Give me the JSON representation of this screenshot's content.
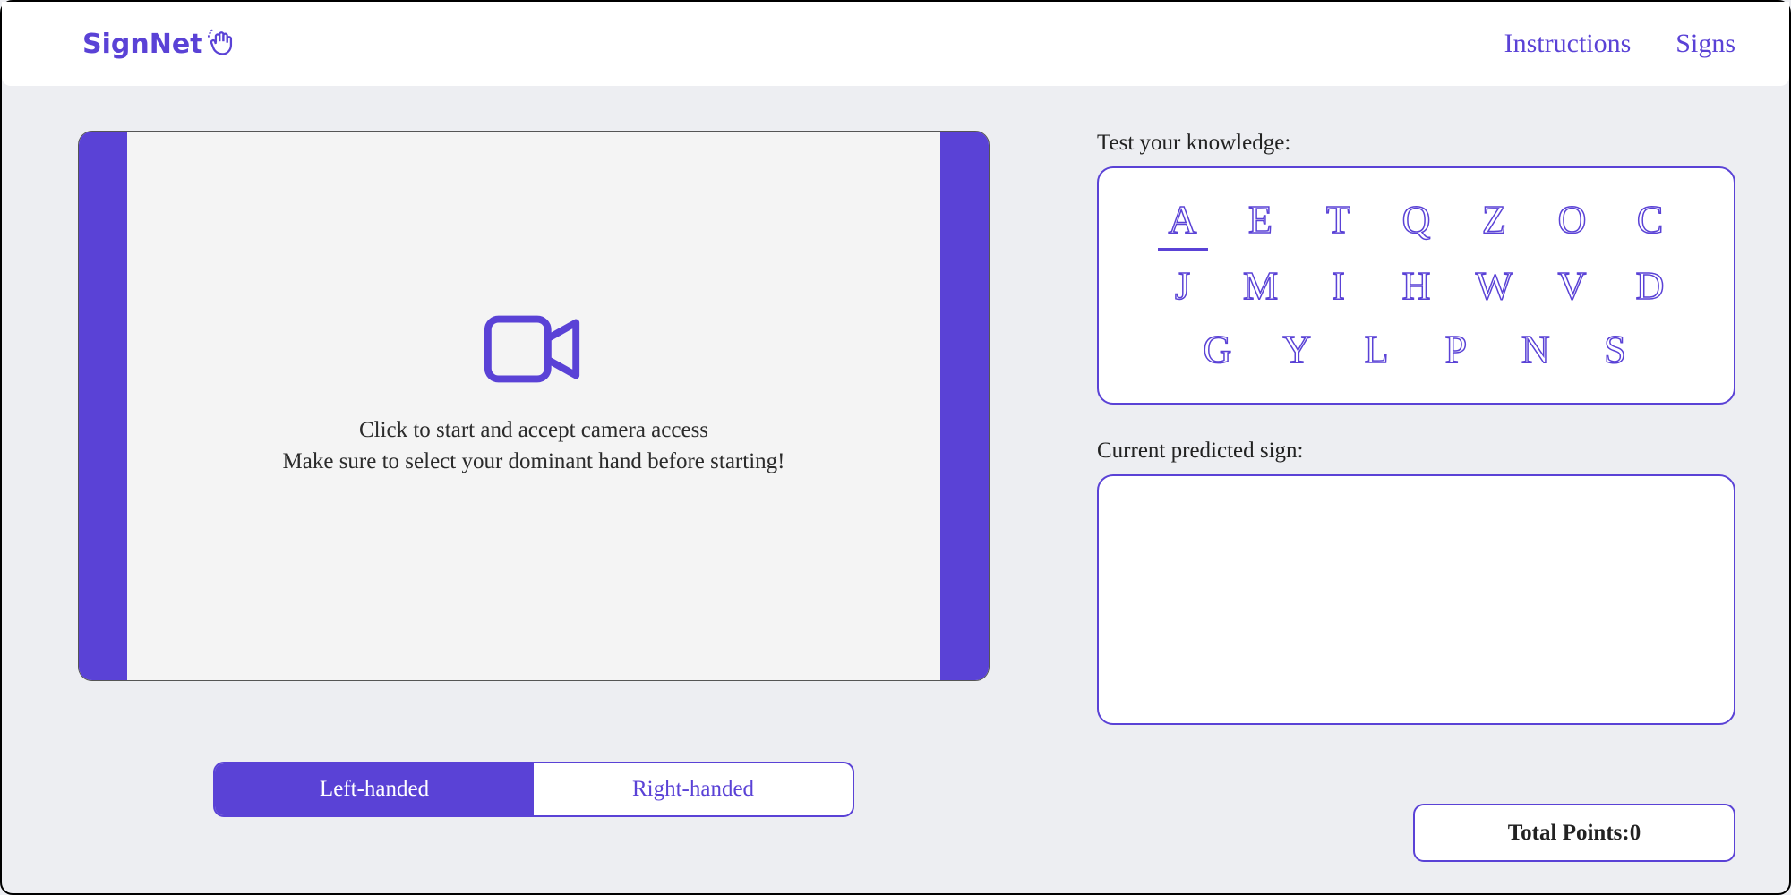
{
  "header": {
    "logo_text": "SignNet",
    "nav": {
      "instructions": "Instructions",
      "signs": "Signs"
    }
  },
  "camera": {
    "line1": "Click to start and accept camera access",
    "line2": "Make sure to select your dominant hand before starting!"
  },
  "hand_toggle": {
    "left": "Left-handed",
    "right": "Right-handed",
    "active": "left"
  },
  "panels": {
    "test_label": "Test your knowledge:",
    "predict_label": "Current predicted sign:"
  },
  "letters": {
    "row1": [
      "A",
      "E",
      "T",
      "Q",
      "Z",
      "O",
      "C"
    ],
    "row2": [
      "J",
      "M",
      "I",
      "H",
      "W",
      "V",
      "D"
    ],
    "row3": [
      "G",
      "Y",
      "L",
      "P",
      "N",
      "S"
    ],
    "selected": "A"
  },
  "points": {
    "label": "Total Points: ",
    "value": "0"
  }
}
